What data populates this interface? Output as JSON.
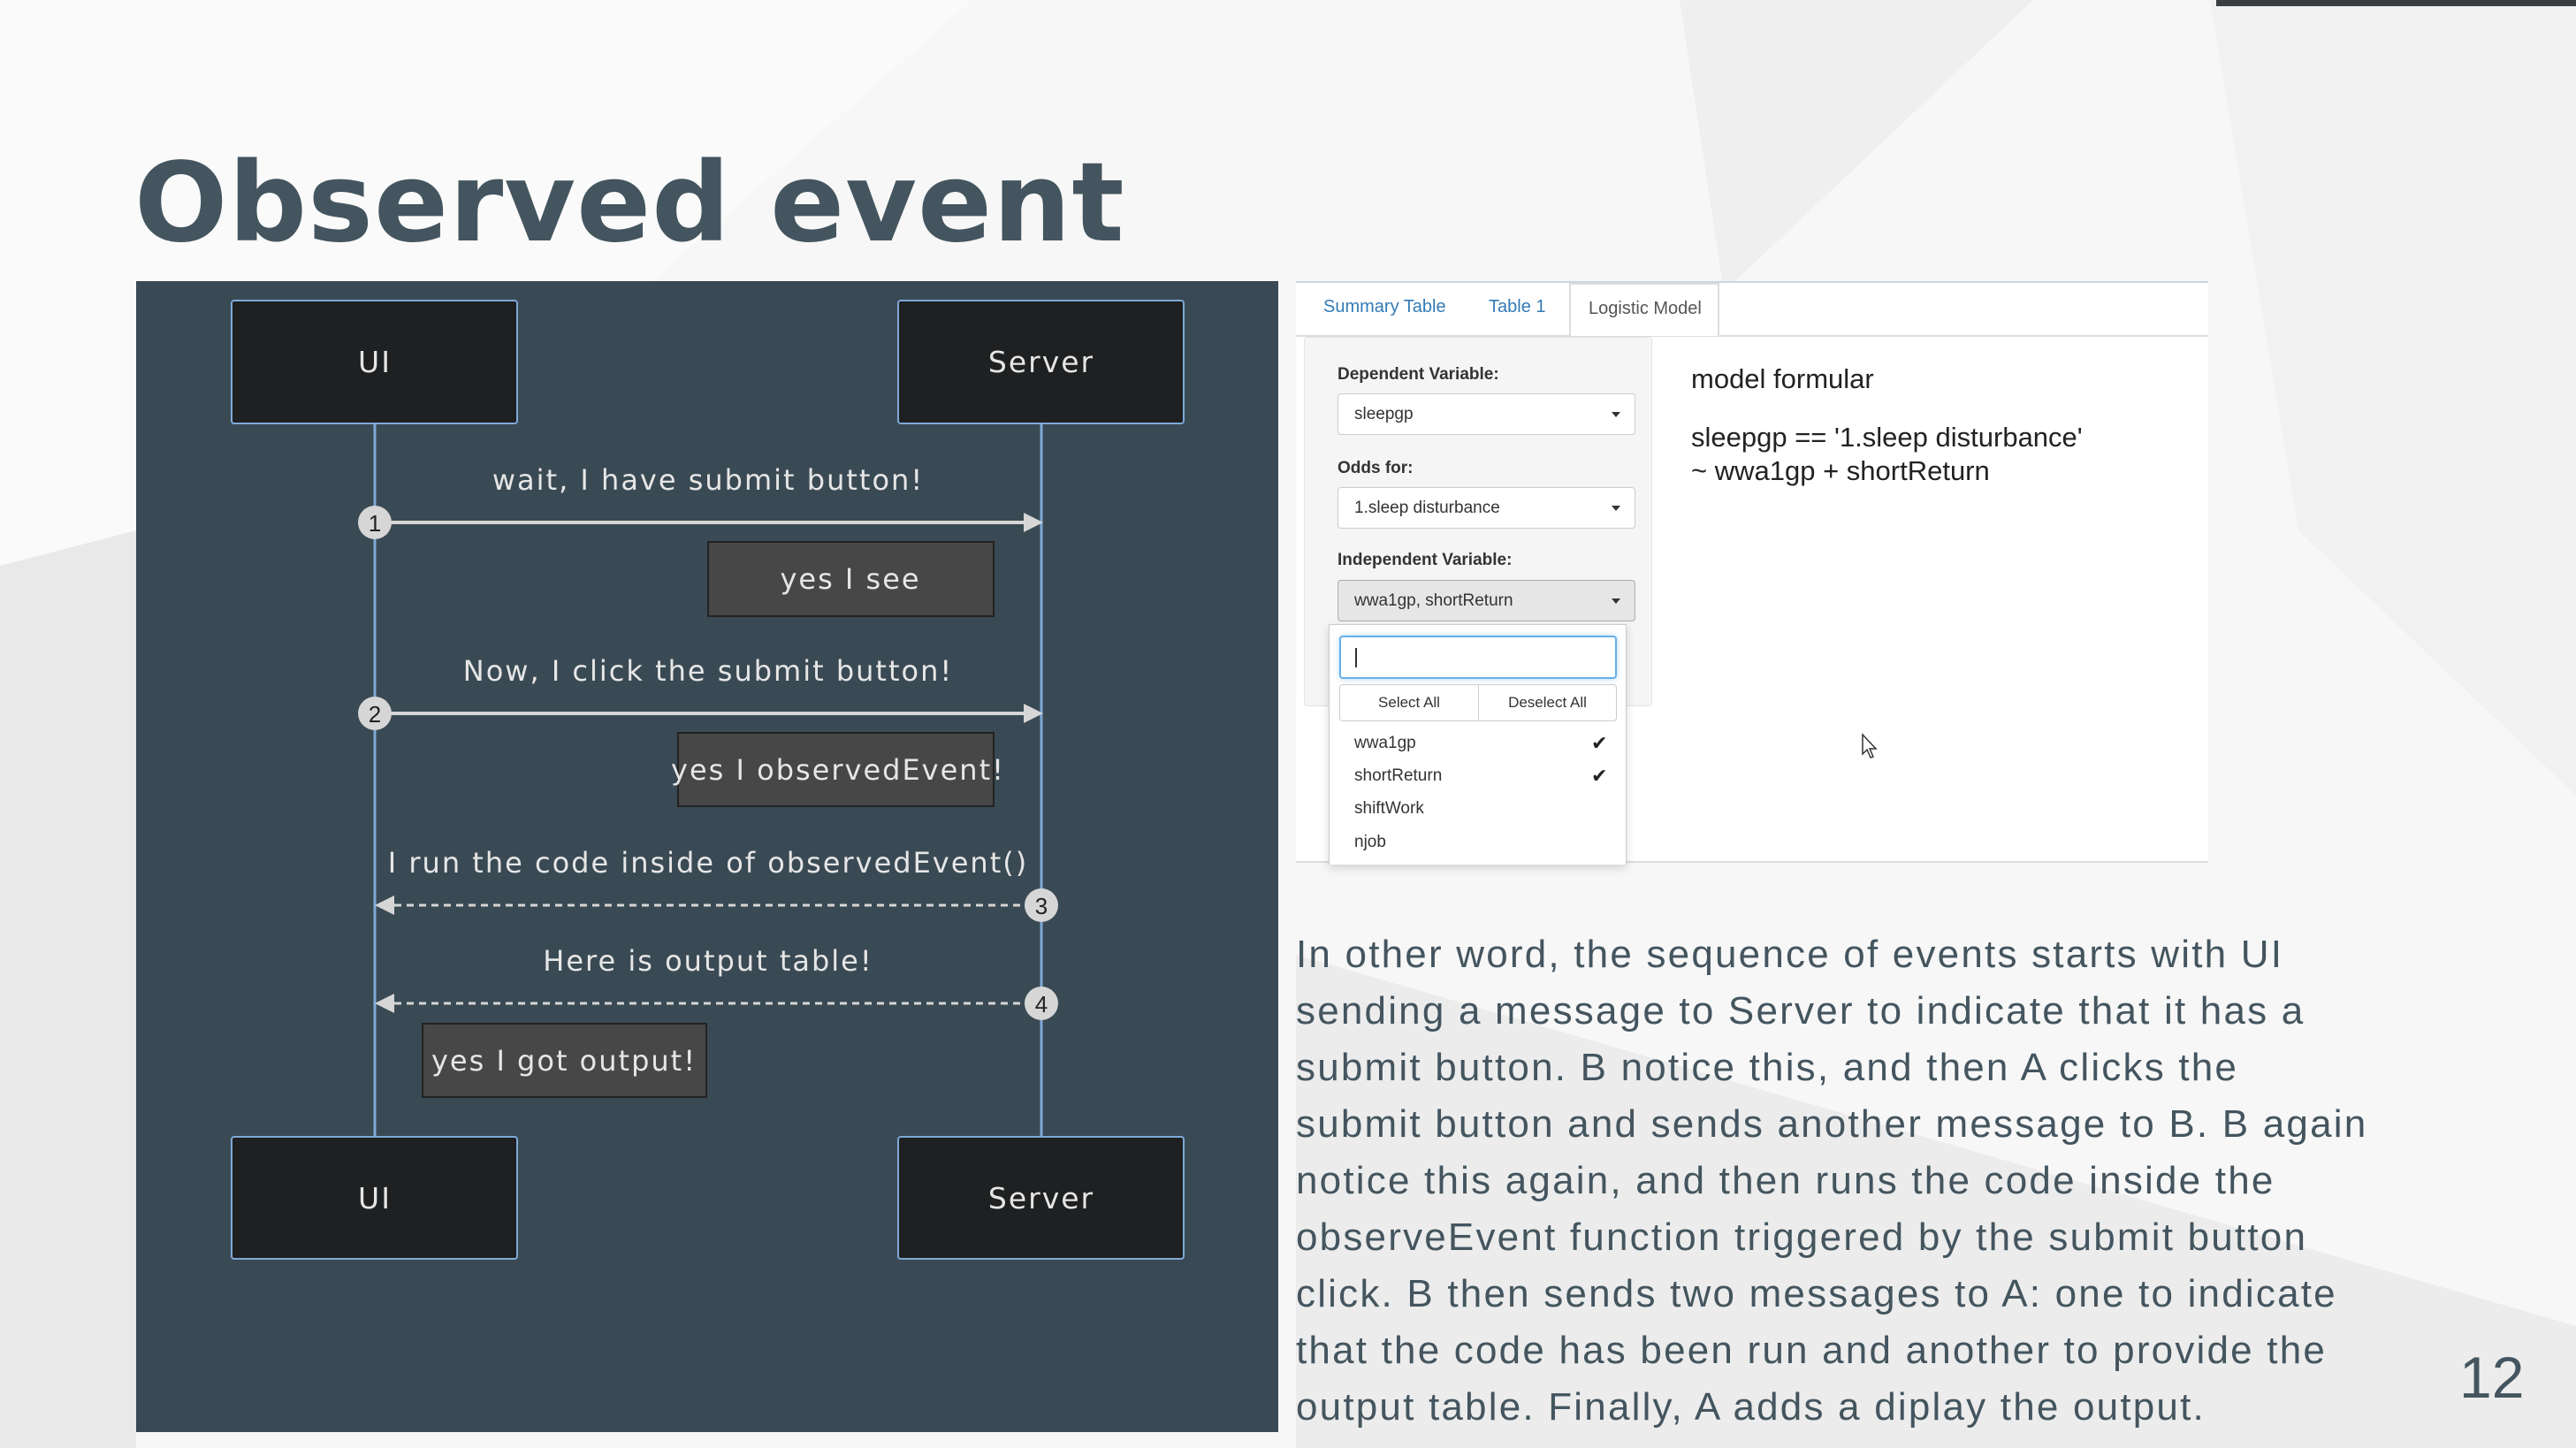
{
  "slide": {
    "title": "Observed event",
    "page_number": "12",
    "accent_color": "#44555f"
  },
  "diagram": {
    "participants": [
      "UI",
      "Server"
    ],
    "messages": [
      {
        "number": "1",
        "label": "wait, I have submit button!",
        "from": "UI",
        "to": "Server",
        "style": "solid"
      },
      {
        "number": "2",
        "label": "Now, I click the submit button!",
        "from": "UI",
        "to": "Server",
        "style": "solid"
      },
      {
        "number": "3",
        "label": "I run the code inside of observedEvent()",
        "from": "Server",
        "to": "UI",
        "style": "dashed"
      },
      {
        "number": "4",
        "label": "Here is output table!",
        "from": "Server",
        "to": "UI",
        "style": "dashed"
      }
    ],
    "notes": [
      "yes I see",
      "yes I observedEvent!",
      "yes I got output!"
    ]
  },
  "app": {
    "tabs": [
      {
        "label": "Summary Table",
        "active": false
      },
      {
        "label": "Table 1",
        "active": false
      },
      {
        "label": "Logistic Model",
        "active": true
      }
    ],
    "dependent_label": "Dependent Variable:",
    "dependent_value": "sleepgp",
    "odds_label": "Odds for:",
    "odds_value": "1.sleep disturbance",
    "independent_label": "Independent Variable:",
    "independent_value": "wwa1gp, shortReturn",
    "dropdown": {
      "search_value": "",
      "select_all": "Select All",
      "deselect_all": "Deselect All",
      "options": [
        {
          "label": "wwa1gp",
          "checked": true
        },
        {
          "label": "shortReturn",
          "checked": true
        },
        {
          "label": "shiftWork",
          "checked": false
        },
        {
          "label": "njob",
          "checked": false
        }
      ],
      "check_glyph": "✔"
    },
    "model_heading": "model formular",
    "formula_line1": "sleepgp == '1.sleep disturbance'",
    "formula_line2": "~ wwa1gp + shortReturn"
  },
  "paragraph": [
    "In other word, the sequence of events starts with UI",
    "sending a message to Server to indicate that it has a",
    "submit button. B notice this, and then A clicks the",
    "submit button and sends another message to B. B again",
    "notice this again, and then runs the code inside the",
    "observeEvent function triggered by the submit button",
    "click. B then sends two messages to A: one to indicate",
    "that the code has been run and another to provide the",
    "output table. Finally, A adds a diplay the output."
  ]
}
